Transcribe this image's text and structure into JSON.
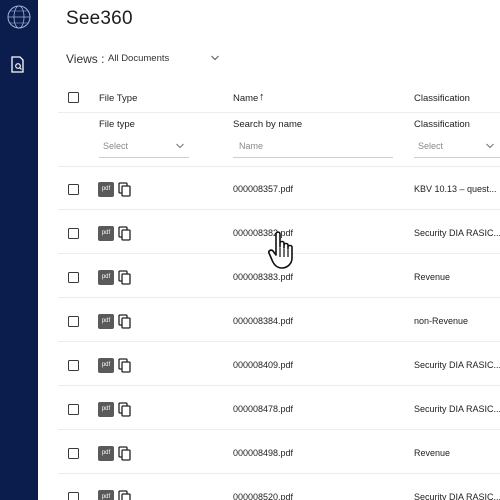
{
  "app": {
    "title": "See360"
  },
  "views": {
    "label": "Views :",
    "value": "All Documents"
  },
  "table": {
    "headers": {
      "file_type": "File Type",
      "name": "Name",
      "name_sort": "↑",
      "classification": "Classification"
    },
    "filters": {
      "file_type": {
        "label": "File type",
        "placeholder": "Select"
      },
      "name": {
        "label": "Search by name",
        "placeholder": "Name"
      },
      "classification": {
        "label": "Classification",
        "placeholder": "Select"
      }
    },
    "rows": [
      {
        "icon": "pdf",
        "name": "000008357.pdf",
        "classification": "KBV 10.13 – quest..."
      },
      {
        "icon": "pdf",
        "name": "000008382.pdf",
        "classification": "Security DIA RASIC..."
      },
      {
        "icon": "pdf",
        "name": "000008383.pdf",
        "classification": "Revenue"
      },
      {
        "icon": "pdf",
        "name": "000008384.pdf",
        "classification": "non-Revenue"
      },
      {
        "icon": "pdf",
        "name": "000008409.pdf",
        "classification": "Security DIA RASIC..."
      },
      {
        "icon": "pdf",
        "name": "000008478.pdf",
        "classification": "Security DIA RASIC..."
      },
      {
        "icon": "pdf",
        "name": "000008498.pdf",
        "classification": "Revenue"
      },
      {
        "icon": "pdf",
        "name": "000008520.pdf",
        "classification": "Security DIA RASIC..."
      }
    ]
  },
  "colors": {
    "sidebar": "#0b1d4d",
    "divider": "#ececec",
    "pdf_badge": "#5a5a5a"
  }
}
